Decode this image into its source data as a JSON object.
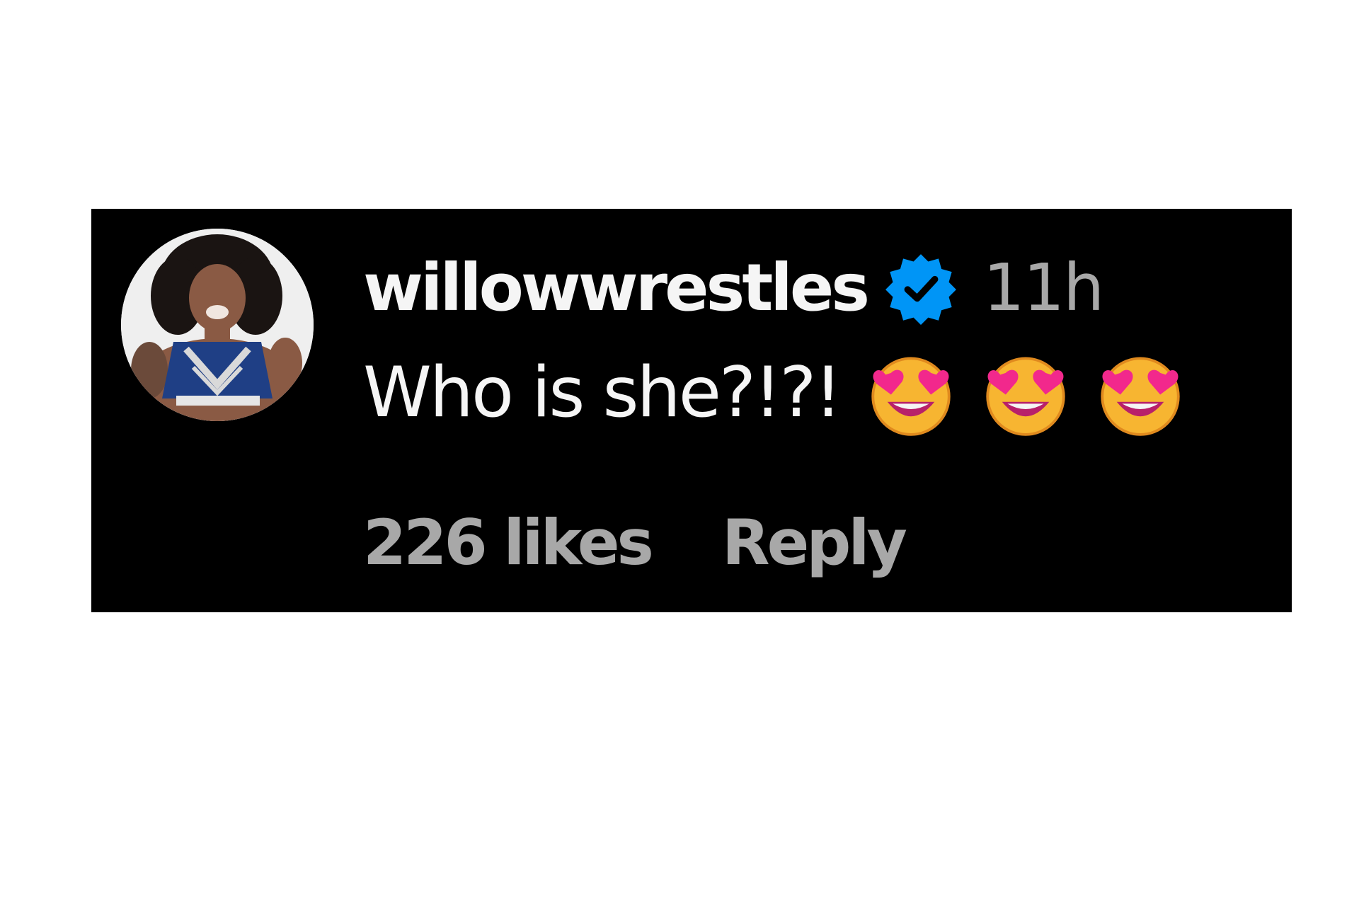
{
  "comment": {
    "username": "willowwrestles",
    "verified": true,
    "timestamp": "11h",
    "text": "Who is she?!?!",
    "emojis": [
      "star-struck-heart-eyes-icon",
      "star-struck-heart-eyes-icon",
      "star-struck-heart-eyes-icon"
    ],
    "likes_label": "226 likes",
    "reply_label": "Reply"
  },
  "colors": {
    "card_background": "#000000",
    "page_background": "#ffffff",
    "primary_text": "#f5f5f5",
    "secondary_text": "#a8a8a8",
    "verified_badge": "#0095f6"
  }
}
